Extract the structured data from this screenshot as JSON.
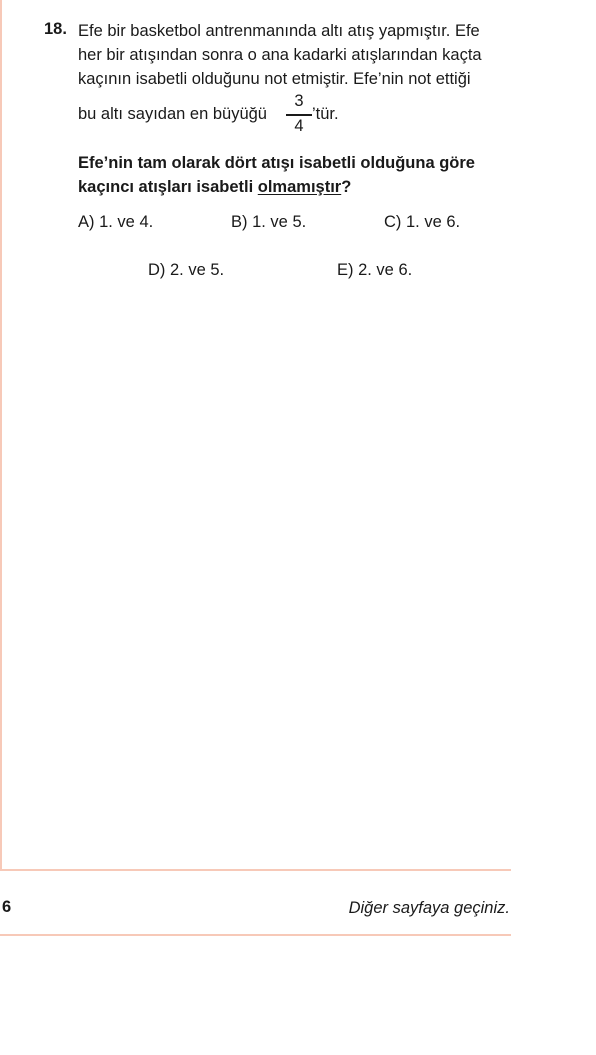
{
  "question": {
    "number": "18.",
    "stem_lines": [
      "Efe bir basketbol antrenmanında altı atış yapmıştır. Efe",
      "her bir atışından sonra o ana kadarki atışlarından kaçta",
      "kaçının isabetli olduğunu not etmiştir. Efe’nin not ettiği",
      "bu altı sayıdan en büyüğü"
    ],
    "fraction": {
      "numerator": "3",
      "denominator": "4"
    },
    "fraction_suffix": "’tür.",
    "bold_line1": "Efe’nin tam olarak dört atışı isabetli olduğuna göre",
    "bold_line2_prefix": "kaçıncı atışları isabetli ",
    "bold_line2_underlined": "olmamıştır",
    "bold_line2_suffix": "?",
    "options": {
      "A": "A) 1. ve 4.",
      "B": "B) 1. ve 5.",
      "C": "C) 1. ve 6.",
      "D": "D) 2. ve 5.",
      "E": "E) 2. ve 6."
    }
  },
  "footer": {
    "page_number": "6",
    "next_page_text": "Diğer sayfaya geçiniz."
  },
  "colors": {
    "rule": "#f7c9b8",
    "text": "#1a1a1a"
  }
}
